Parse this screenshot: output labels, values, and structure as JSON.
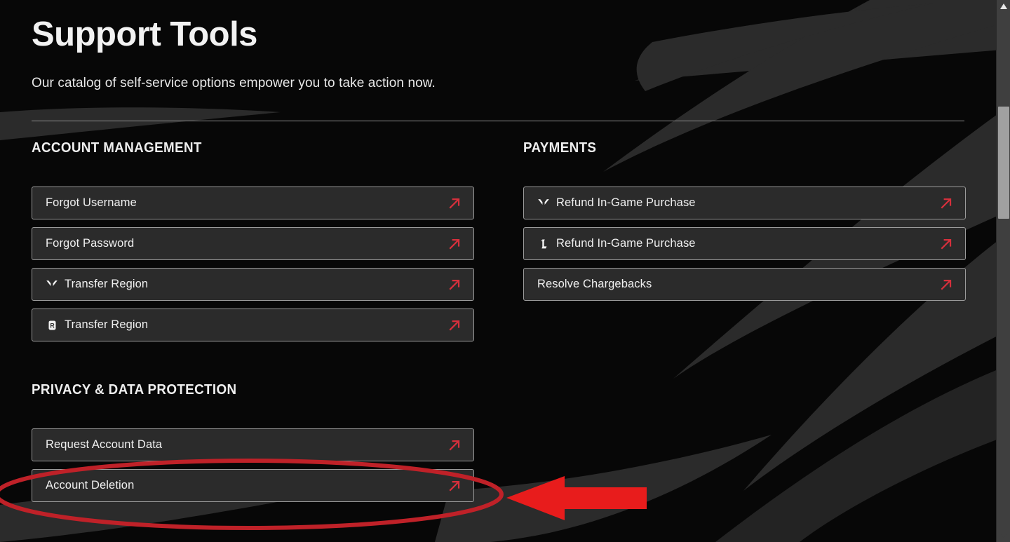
{
  "header": {
    "title": "Support Tools",
    "subtitle": "Our catalog of self-service options empower you to take action now."
  },
  "colors": {
    "page_background": "#070707",
    "background_swoosh": "#2b2b2b",
    "button_fill": "#2b2b2b",
    "button_border": "#9b9b9b",
    "text_primary": "#f0f0f0",
    "accent_arrow": "#d6303c",
    "annotation_red": "#c02026",
    "annotation_arrow_red": "#e81c1c",
    "scrollbar_track": "#3f3f3f",
    "scrollbar_thumb": "#a0a0a0"
  },
  "columns": {
    "left": {
      "sections": [
        {
          "title": "ACCOUNT MANAGEMENT",
          "items": [
            {
              "label": "Forgot Username",
              "icon": "",
              "arrow_icon": "external-link-arrow-icon"
            },
            {
              "label": "Forgot Password",
              "icon": "",
              "arrow_icon": "external-link-arrow-icon"
            },
            {
              "label": "Transfer Region",
              "icon": "valorant-logo-icon",
              "arrow_icon": "external-link-arrow-icon"
            },
            {
              "label": "Transfer Region",
              "icon": "riot-games-logo-icon",
              "arrow_icon": "external-link-arrow-icon"
            }
          ]
        },
        {
          "title": "PRIVACY & DATA PROTECTION",
          "items": [
            {
              "label": "Request Account Data",
              "icon": "",
              "arrow_icon": "external-link-arrow-icon"
            },
            {
              "label": "Account Deletion",
              "icon": "",
              "arrow_icon": "external-link-arrow-icon"
            }
          ]
        }
      ]
    },
    "right": {
      "sections": [
        {
          "title": "PAYMENTS",
          "items": [
            {
              "label": "Refund In-Game Purchase",
              "icon": "valorant-logo-icon",
              "arrow_icon": "external-link-arrow-icon"
            },
            {
              "label": "Refund In-Game Purchase",
              "icon": "league-of-legends-logo-icon",
              "arrow_icon": "external-link-arrow-icon"
            },
            {
              "label": "Resolve Chargebacks",
              "icon": "",
              "arrow_icon": "external-link-arrow-icon"
            }
          ]
        }
      ]
    }
  },
  "annotations": {
    "ellipse": {
      "name": "highlight-ellipse",
      "target": "Account Deletion"
    },
    "arrow": {
      "name": "pointer-arrow",
      "direction": "left",
      "target": "Account Deletion"
    }
  },
  "scrollbar": {
    "up_arrow": "scroll-up-arrow-icon",
    "down_arrow": "scroll-down-arrow-icon",
    "thumb": "scroll-thumb"
  }
}
